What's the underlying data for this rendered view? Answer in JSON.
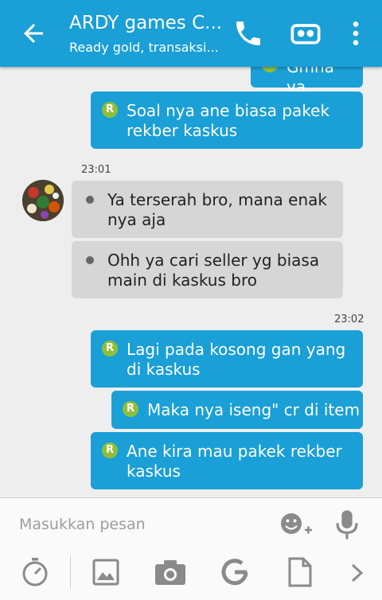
{
  "header": {
    "title": "ARDY games C...",
    "subtitle": "Ready gold, transaksi...",
    "back_icon": "arrow-left-icon",
    "call_icon": "phone-icon",
    "sticker_icon": "mask-icon",
    "menu_icon": "more-vert-icon",
    "bg_color": "#1a9fd6"
  },
  "messages": [
    {
      "side": "out",
      "text": "Gmna ya"
    },
    {
      "side": "out",
      "text": "Soal nya ane biasa pakek rekber kaskus"
    },
    {
      "side": "in",
      "time": "23:01",
      "text": "Ya terserah bro, mana enak nya aja"
    },
    {
      "side": "in",
      "text": "Ohh ya cari seller yg biasa main di kaskus bro"
    },
    {
      "side": "out",
      "time": "23:02",
      "text": "Lagi pada kosong gan yang di kaskus"
    },
    {
      "side": "out",
      "text": "Maka nya iseng\" cr di item"
    },
    {
      "side": "out",
      "text": "Ane kira mau pakek rekber kaskus"
    }
  ],
  "badge_letter": "R",
  "composer": {
    "placeholder": "Masukkan pesan",
    "emoji_icon": "add-emoji-icon",
    "mic_icon": "mic-icon",
    "tools": [
      "timer-icon",
      "image-icon",
      "camera-icon",
      "google-icon",
      "file-icon",
      "chevron-right-icon"
    ]
  }
}
